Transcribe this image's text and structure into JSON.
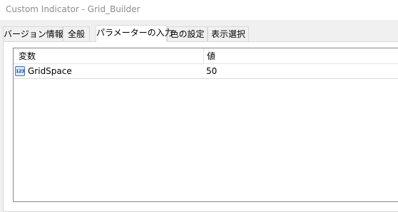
{
  "window": {
    "title": "Custom Indicator - Grid_Builder"
  },
  "tabs": [
    {
      "label": "バージョン情報",
      "active": false
    },
    {
      "label": "全般",
      "active": false
    },
    {
      "label": "パラメーターの入力",
      "active": true
    },
    {
      "label": "色の設定",
      "active": false
    },
    {
      "label": "表示選択",
      "active": false
    }
  ],
  "params": {
    "columns": {
      "variable": "変数",
      "value": "値"
    },
    "rows": [
      {
        "type_icon": "123",
        "icon_name": "integer-type-icon",
        "name": "GridSpace",
        "value": "50"
      }
    ]
  }
}
